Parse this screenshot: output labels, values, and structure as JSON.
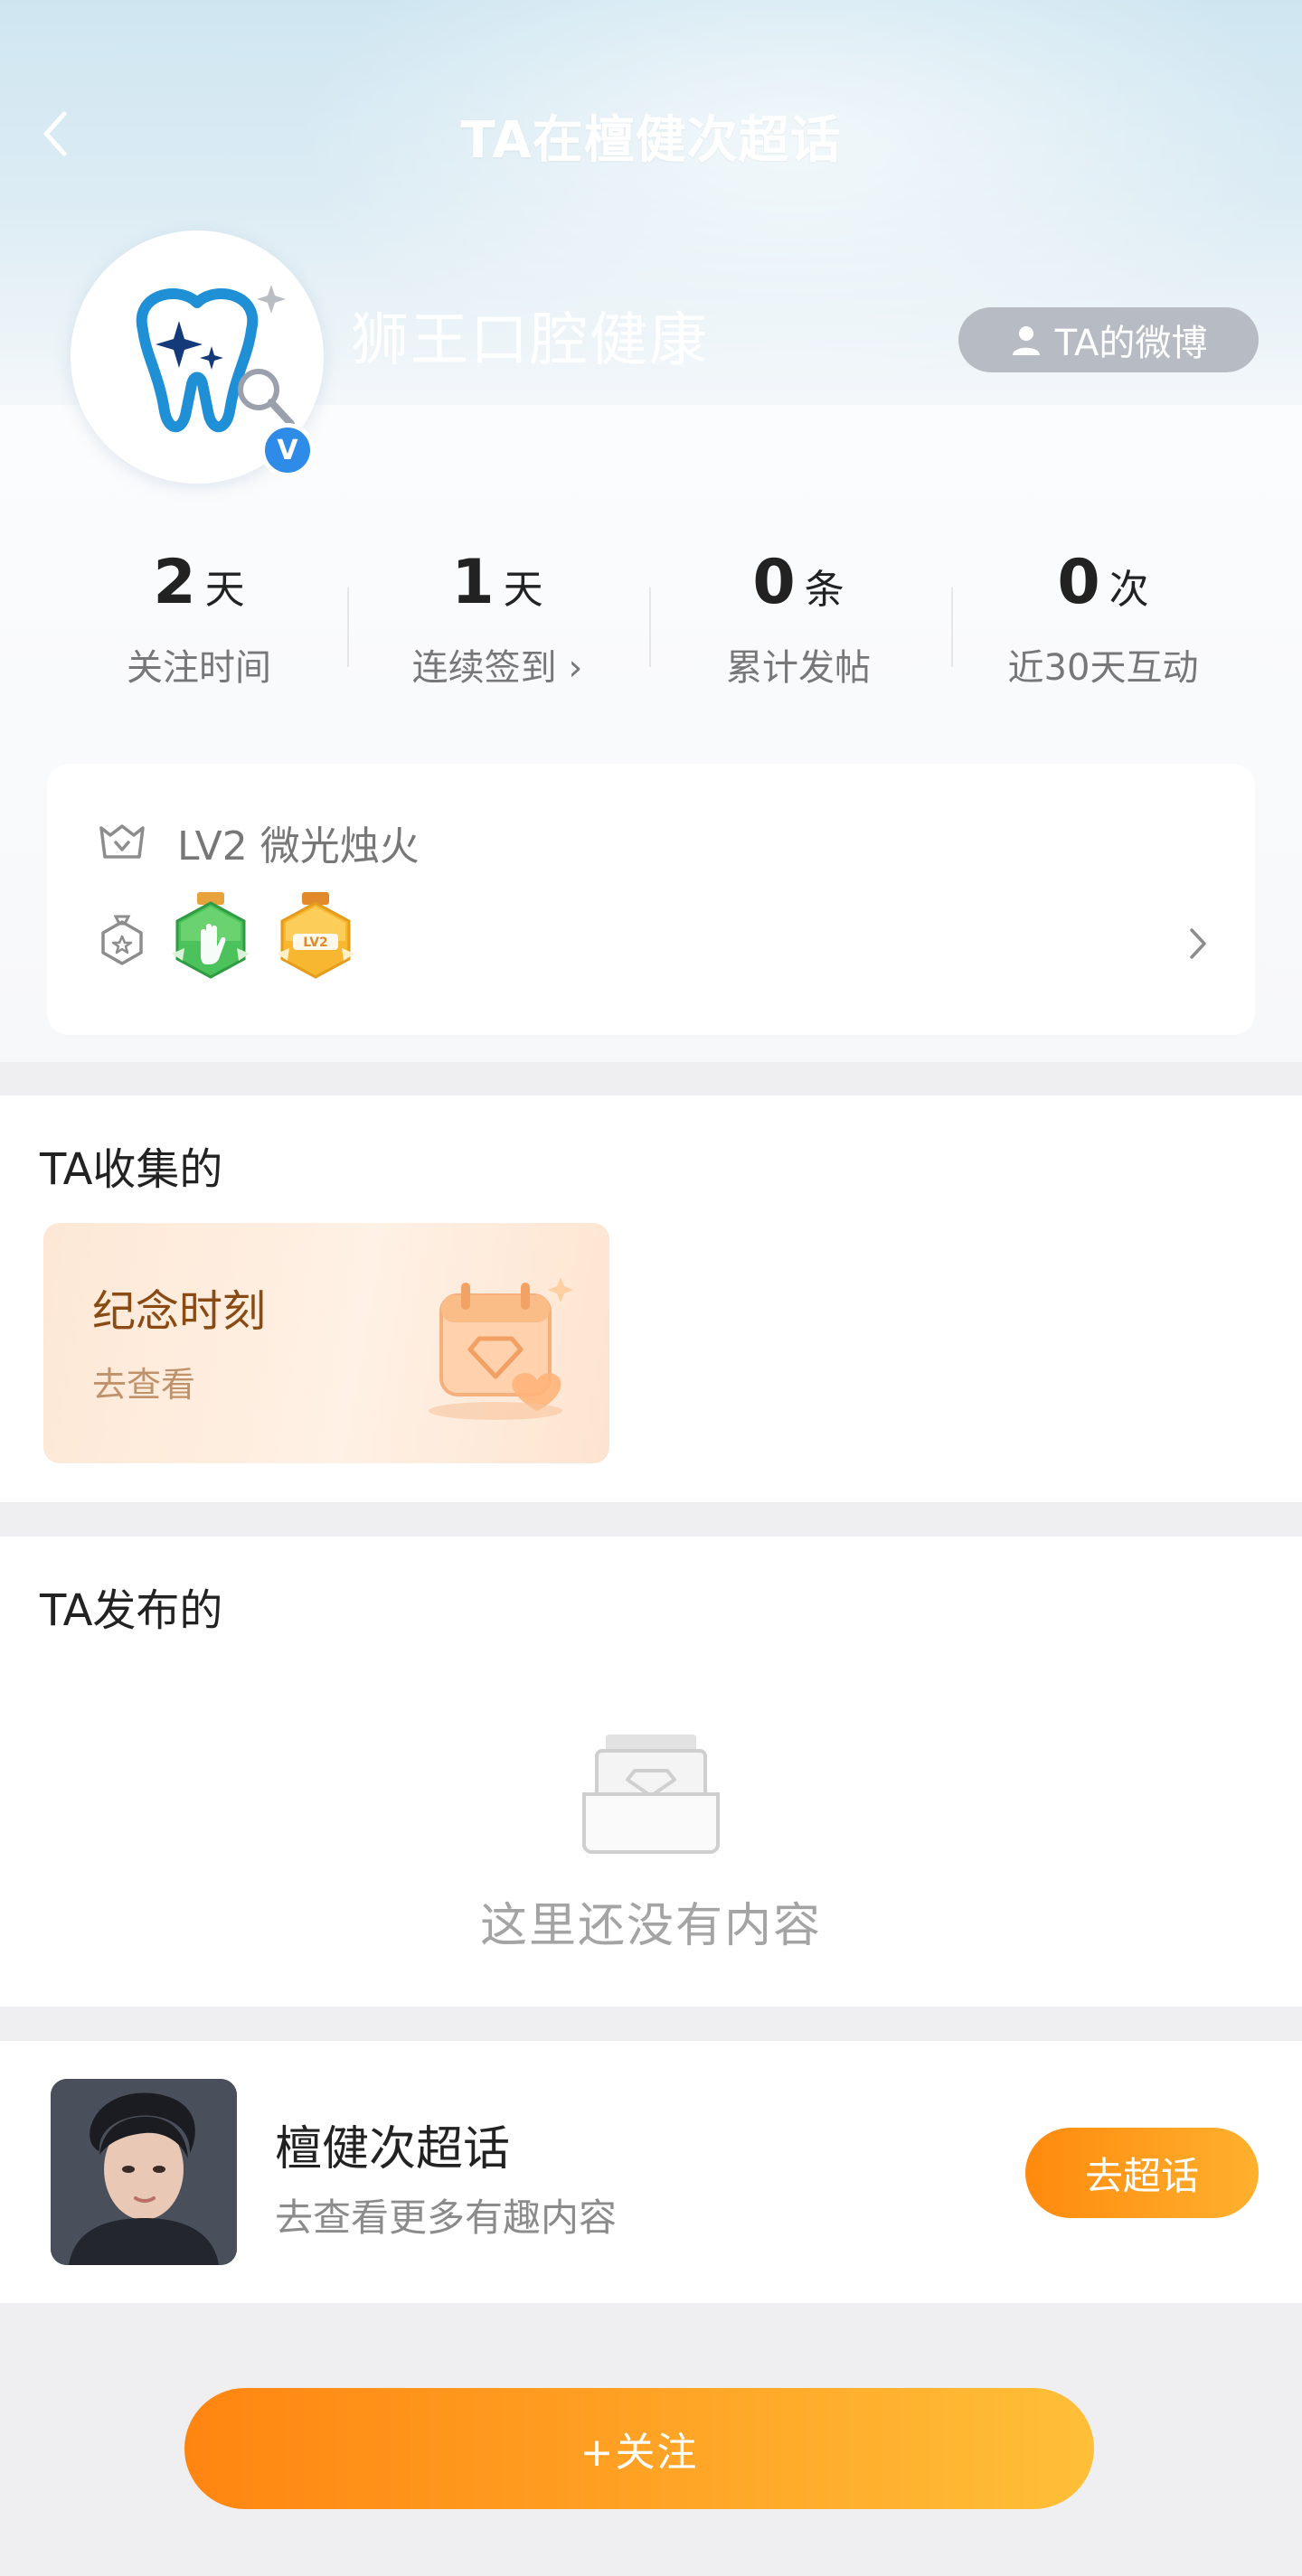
{
  "nav": {
    "title": "TA在檀健次超话"
  },
  "profile": {
    "name": "狮王口腔健康",
    "verified_mark": "V",
    "weibo_button": "TA的微博"
  },
  "stats": [
    {
      "value": "2",
      "unit": "天",
      "label": "关注时间"
    },
    {
      "value": "1",
      "unit": "天",
      "label": "连续签到 ›"
    },
    {
      "value": "0",
      "unit": "条",
      "label": "累计发帖"
    },
    {
      "value": "0",
      "unit": "次",
      "label": "近30天互动"
    }
  ],
  "level": {
    "text": "LV2 微光烛火",
    "badge_lv_text": "LV2"
  },
  "collected": {
    "title": "TA收集的",
    "card_title": "纪念时刻",
    "card_sub": "去查看"
  },
  "posted": {
    "title": "TA发布的",
    "empty_text": "这里还没有内容"
  },
  "topic": {
    "name": "檀健次超话",
    "sub": "去查看更多有趣内容",
    "button": "去超话"
  },
  "follow_button": "+关注",
  "colors": {
    "accent_orange": "#ff8a0e",
    "verified_blue": "#2e8be8",
    "header_blue": "#cfe6f1"
  }
}
